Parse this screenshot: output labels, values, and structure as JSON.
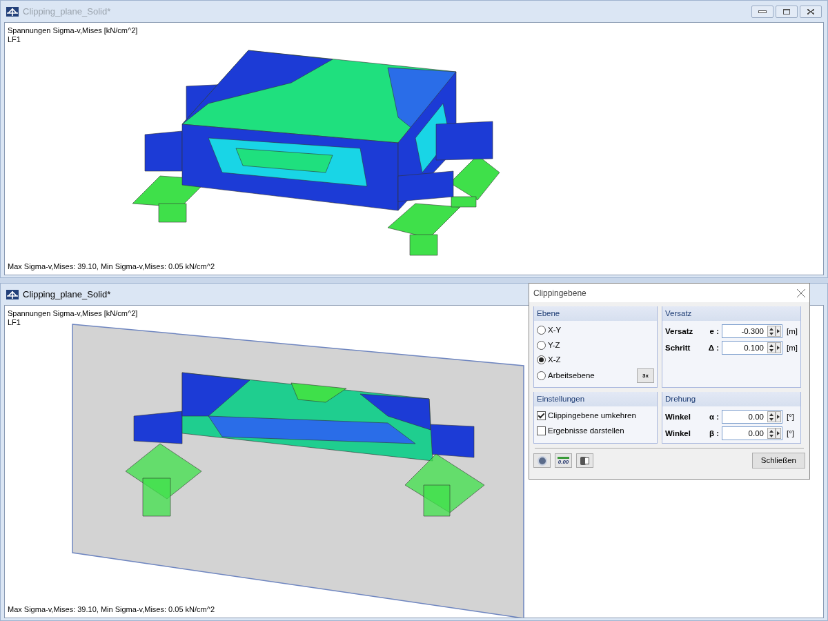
{
  "windows": [
    {
      "title": "Clipping_plane_Solid*",
      "active": false,
      "kind": "full",
      "header_lines": [
        "Spannungen Sigma-v,Mises [kN/cm^2]",
        "LF1"
      ],
      "footer": "Max Sigma-v,Mises: 39.10, Min Sigma-v,Mises: 0.05 kN/cm^2"
    },
    {
      "title": "Clipping_plane_Solid*",
      "active": true,
      "kind": "clipped",
      "header_lines": [
        "Spannungen Sigma-v,Mises [kN/cm^2]",
        "LF1"
      ],
      "footer": "Max Sigma-v,Mises: 39.10, Min Sigma-v,Mises: 0.05 kN/cm^2"
    }
  ],
  "dialog": {
    "title": "Clippingebene",
    "ebene": {
      "title": "Ebene",
      "options": [
        {
          "label": "X-Y",
          "selected": false
        },
        {
          "label": "Y-Z",
          "selected": false
        },
        {
          "label": "X-Z",
          "selected": true
        },
        {
          "label": "Arbeitsebene",
          "selected": false
        }
      ],
      "pick_button": "3x"
    },
    "versatz": {
      "title": "Versatz",
      "fields": [
        {
          "label": "Versatz",
          "symbol": "e :",
          "value": "-0.300",
          "unit": "[m]"
        },
        {
          "label": "Schritt",
          "symbol": "Δ :",
          "value": "0.100",
          "unit": "[m]"
        }
      ]
    },
    "einstellungen": {
      "title": "Einstellungen",
      "checkboxes": [
        {
          "label": "Clippingebene umkehren",
          "checked": true
        },
        {
          "label": "Ergebnisse darstellen",
          "checked": false
        }
      ]
    },
    "drehung": {
      "title": "Drehung",
      "fields": [
        {
          "label": "Winkel",
          "symbol": "α :",
          "value": "0.00",
          "unit": "[°]"
        },
        {
          "label": "Winkel",
          "symbol": "β :",
          "value": "0.00",
          "unit": "[°]"
        }
      ]
    },
    "decimal_button": "0.00",
    "close_button": "Schließen"
  }
}
